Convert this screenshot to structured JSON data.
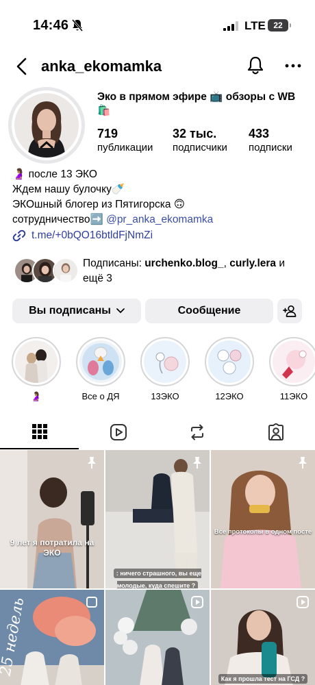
{
  "status": {
    "time": "14:46",
    "network": "LTE",
    "battery": "22"
  },
  "header": {
    "username": "anka_ekomamka"
  },
  "profile": {
    "name": "Эко в прямом эфире 📺 обзоры с WB🛍️",
    "stats": [
      {
        "value": "719",
        "label": "публикации"
      },
      {
        "value": "32 тыс.",
        "label": "подписчики"
      },
      {
        "value": "433",
        "label": "подписки"
      }
    ],
    "bio": [
      "🤰🏽 после 13 ЭКО",
      "Ждем нашу булочку🍼",
      "ЭКОшный блогер из Пятигорска 🙃"
    ],
    "bio_collab_prefix": "сотрудничество➡️ ",
    "bio_collab_handle": "@pr_anka_ekomamka",
    "link": "t.me/+0bQO16btldFjNmZi"
  },
  "followed_by": {
    "prefix": "Подписаны: ",
    "user1": "urchenko.blog_",
    "separator": ", ",
    "user2": "curly.lera",
    "suffix": " и ещё 3"
  },
  "buttons": {
    "following": "Вы подписаны",
    "message": "Сообщение"
  },
  "highlights": [
    {
      "label": "🤰🏽"
    },
    {
      "label": "Все о ДЯ"
    },
    {
      "label": "13ЭКО"
    },
    {
      "label": "12ЭКО"
    },
    {
      "label": "11ЭКО"
    }
  ],
  "posts": [
    {
      "caption": "9 лет я потратила на ЭКО"
    },
    {
      "caption": ": ничего страшного, вы еще молодые, куда спешите ?"
    },
    {
      "caption": "Все протоколы в одном посте"
    },
    {
      "caption": "25 недель"
    },
    {
      "caption": ""
    },
    {
      "caption": "Как я прошла тест на ГСД ?"
    }
  ],
  "colors": {
    "link": "#3a4ea8",
    "button_bg": "#efeff1"
  }
}
